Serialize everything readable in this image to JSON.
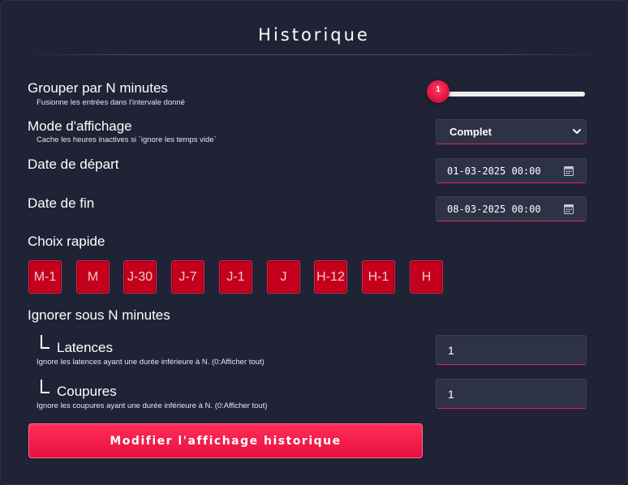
{
  "title": "Historique",
  "group": {
    "label": "Grouper par N minutes",
    "hint": "Fusionne les entrées dans l'intervale donné",
    "slider_value": "1"
  },
  "display": {
    "label": "Mode d'affichage",
    "hint": "Cache les heures inactives si `ignore les temps vide`",
    "selected": "Complet"
  },
  "start": {
    "label": "Date de départ",
    "value": "01-03-2025 00:00"
  },
  "end": {
    "label": "Date de fin",
    "value": "08-03-2025 00:00"
  },
  "quick": {
    "label": "Choix rapide",
    "buttons": [
      "M-1",
      "M",
      "J-30",
      "J-7",
      "J-1",
      "J",
      "H-12",
      "H-1",
      "H"
    ]
  },
  "ignore": {
    "label": "Ignorer sous N minutes",
    "latency": {
      "label": "Latences",
      "hint": "Ignore les latences ayant une durée inférieure à N. (0:Afficher tout)",
      "value": "1"
    },
    "cuts": {
      "label": "Coupures",
      "hint": "Ignore les coupures ayant une durée inférieure à N. (0:Afficher tout)",
      "value": "1"
    }
  },
  "submit_label": "Modifier l'affichage historique",
  "colors": {
    "background": "#1f2335",
    "accent": "#e8103f",
    "quick_button": "#c5001d",
    "field": "#2e3246"
  },
  "icons": {
    "select": "chevron-down-icon",
    "date": "calendar-icon",
    "indent": "corner-bracket-icon"
  }
}
